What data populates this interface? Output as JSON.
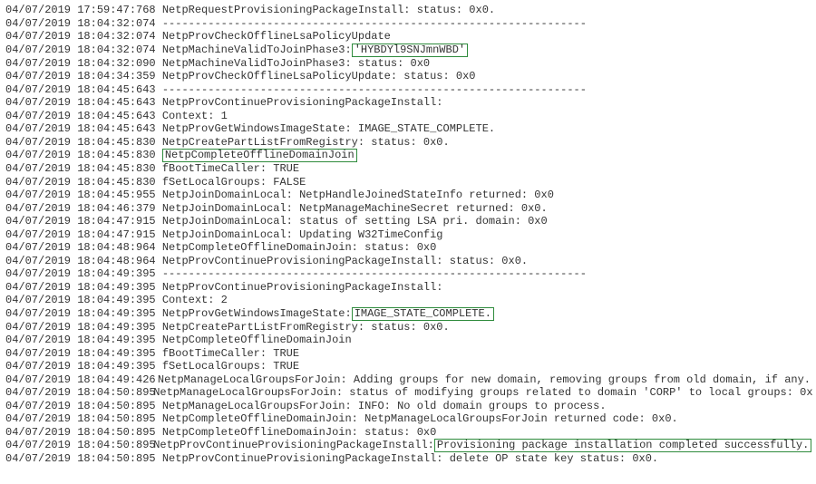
{
  "log": {
    "lines": [
      {
        "ts": "04/07/2019 17:59:47:768",
        "msg": "NetpRequestProvisioningPackageInstall: status: 0x0."
      },
      {
        "ts": "04/07/2019 18:04:32:074",
        "msg": "-----------------------------------------------------------------"
      },
      {
        "ts": "04/07/2019 18:04:32:074",
        "msg": "NetpProvCheckOfflineLsaPolicyUpdate"
      },
      {
        "ts": "04/07/2019 18:04:32:074",
        "msg_pre": "NetpMachineValidToJoinPhase3: ",
        "hl": "'HYBDYl9SNJmnWBD'",
        "msg_post": ""
      },
      {
        "ts": "04/07/2019 18:04:32:090",
        "msg": "NetpMachineValidToJoinPhase3: status: 0x0"
      },
      {
        "ts": "04/07/2019 18:04:34:359",
        "msg": "NetpProvCheckOfflineLsaPolicyUpdate: status: 0x0"
      },
      {
        "ts": "04/07/2019 18:04:45:643",
        "msg": "-----------------------------------------------------------------"
      },
      {
        "ts": "04/07/2019 18:04:45:643",
        "msg": "NetpProvContinueProvisioningPackageInstall:"
      },
      {
        "ts": "04/07/2019 18:04:45:643",
        "msg": "            Context: 1"
      },
      {
        "ts": "04/07/2019 18:04:45:643",
        "msg": "NetpProvGetWindowsImageState: IMAGE_STATE_COMPLETE."
      },
      {
        "ts": "04/07/2019 18:04:45:830",
        "msg": "NetpCreatePartListFromRegistry: status: 0x0."
      },
      {
        "ts": "04/07/2019 18:04:45:830",
        "msg_pre": "",
        "hl": "NetpCompleteOfflineDomainJoin",
        "msg_post": ""
      },
      {
        "ts": "04/07/2019 18:04:45:830",
        "msg": "            fBootTimeCaller: TRUE"
      },
      {
        "ts": "04/07/2019 18:04:45:830",
        "msg": "            fSetLocalGroups: FALSE"
      },
      {
        "ts": "04/07/2019 18:04:45:955",
        "msg": "NetpJoinDomainLocal: NetpHandleJoinedStateInfo returned: 0x0"
      },
      {
        "ts": "04/07/2019 18:04:46:379",
        "msg": "NetpJoinDomainLocal: NetpManageMachineSecret returned: 0x0."
      },
      {
        "ts": "04/07/2019 18:04:47:915",
        "msg": "NetpJoinDomainLocal: status of setting LSA pri. domain: 0x0"
      },
      {
        "ts": "04/07/2019 18:04:47:915",
        "msg": "NetpJoinDomainLocal: Updating W32TimeConfig"
      },
      {
        "ts": "04/07/2019 18:04:48:964",
        "msg": "NetpCompleteOfflineDomainJoin: status: 0x0"
      },
      {
        "ts": "04/07/2019 18:04:48:964",
        "msg": "NetpProvContinueProvisioningPackageInstall: status: 0x0."
      },
      {
        "ts": "04/07/2019 18:04:49:395",
        "msg": "-----------------------------------------------------------------"
      },
      {
        "ts": "04/07/2019 18:04:49:395",
        "msg": "NetpProvContinueProvisioningPackageInstall:"
      },
      {
        "ts": "04/07/2019 18:04:49:395",
        "msg": "            Context: 2"
      },
      {
        "ts": "04/07/2019 18:04:49:395",
        "msg_pre": "NetpProvGetWindowsImageState: ",
        "hl": "IMAGE_STATE_COMPLETE.",
        "msg_post": ""
      },
      {
        "ts": "04/07/2019 18:04:49:395",
        "msg": "NetpCreatePartListFromRegistry: status: 0x0."
      },
      {
        "ts": "04/07/2019 18:04:49:395",
        "msg": "NetpCompleteOfflineDomainJoin"
      },
      {
        "ts": "04/07/2019 18:04:49:395",
        "msg": "            fBootTimeCaller: TRUE"
      },
      {
        "ts": "04/07/2019 18:04:49:395",
        "msg": "            fSetLocalGroups: TRUE"
      },
      {
        "ts": "04/07/2019 18:04:49:426",
        "msg": "NetpManageLocalGroupsForJoin: Adding groups for new domain, removing groups from old domain, if any."
      },
      {
        "ts": "04/07/2019 18:04:50:895",
        "msg": "NetpManageLocalGroupsForJoin: status of modifying groups related to domain 'CORP' to local groups: 0x"
      },
      {
        "ts": "04/07/2019 18:04:50:895",
        "msg": "NetpManageLocalGroupsForJoin: INFO: No old domain groups to process."
      },
      {
        "ts": "04/07/2019 18:04:50:895",
        "msg": "NetpCompleteOfflineDomainJoin: NetpManageLocalGroupsForJoin returned code: 0x0."
      },
      {
        "ts": "04/07/2019 18:04:50:895",
        "msg": "NetpCompleteOfflineDomainJoin: status: 0x0"
      },
      {
        "ts": "04/07/2019 18:04:50:895",
        "msg_pre": "NetpProvContinueProvisioningPackageInstall: ",
        "hl": "Provisioning package installation completed successfully.",
        "msg_post": ""
      },
      {
        "ts": "04/07/2019 18:04:50:895",
        "msg": "NetpProvContinueProvisioningPackageInstall: delete OP state key status: 0x0."
      }
    ]
  }
}
